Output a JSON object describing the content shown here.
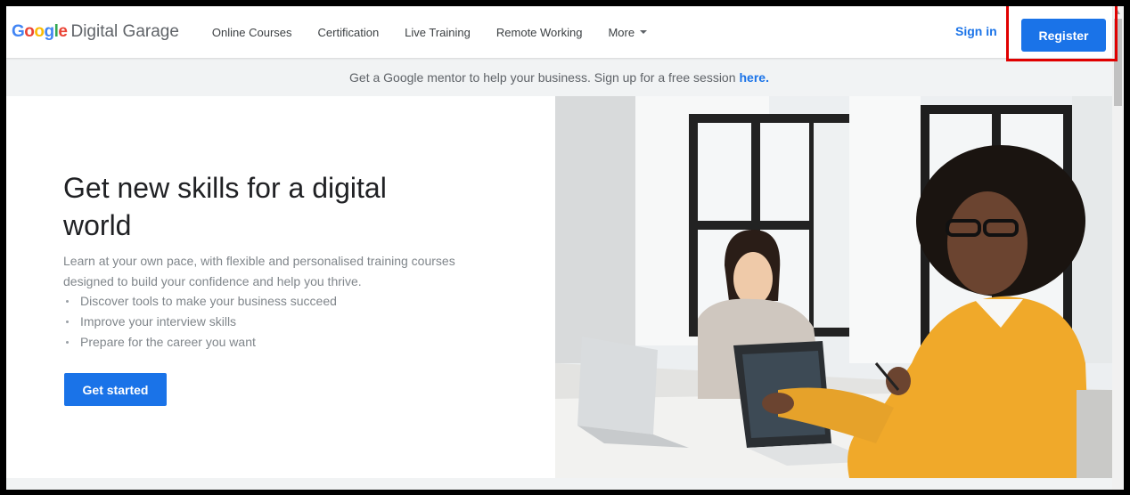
{
  "header": {
    "logo": {
      "brand_letters": [
        {
          "char": "G",
          "color": "#4285F4"
        },
        {
          "char": "o",
          "color": "#EA4335"
        },
        {
          "char": "o",
          "color": "#FBBC05"
        },
        {
          "char": "g",
          "color": "#4285F4"
        },
        {
          "char": "l",
          "color": "#34A853"
        },
        {
          "char": "e",
          "color": "#EA4335"
        }
      ],
      "product": "Digital Garage"
    },
    "nav": [
      {
        "label": "Online Courses"
      },
      {
        "label": "Certification"
      },
      {
        "label": "Live Training"
      },
      {
        "label": "Remote Working"
      },
      {
        "label": "More"
      }
    ],
    "sign_in": "Sign in",
    "register": "Register"
  },
  "banner": {
    "text": "Get a Google mentor to help your business. Sign up for a free session",
    "link": "here."
  },
  "hero": {
    "title": "Get new skills for a digital world",
    "description": "Learn at your own pace, with flexible and personalised training courses designed to build your confidence and help you thrive.",
    "bullets": [
      "Discover tools to make your business succeed",
      "Improve your interview skills",
      "Prepare for the career you want"
    ],
    "cta": "Get started"
  },
  "colors": {
    "accent": "#1a73e8",
    "highlight_box": "#e00000"
  }
}
